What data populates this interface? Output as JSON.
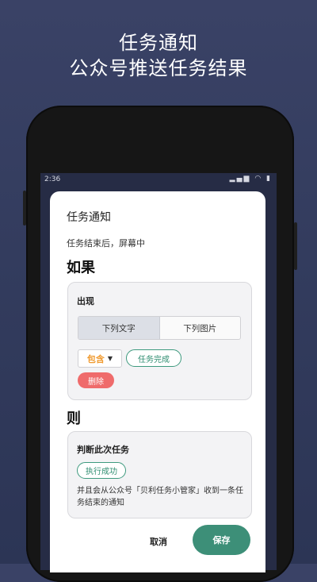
{
  "promo": {
    "line1": "任务通知",
    "line2": "公众号推送任务结果"
  },
  "status_bar": {
    "time": "2:36",
    "icons": [
      "signal-icon",
      "wifi-icon",
      "battery-icon"
    ]
  },
  "dialog": {
    "title": "任务通知",
    "subtitle": "任务结束后，屏幕中",
    "if_label": "如果",
    "condition": {
      "label": "出现",
      "segments": [
        "下列文字",
        "下列图片"
      ],
      "selected_segment": "下列文字",
      "match_value": "包含",
      "keyword_chip": "任务完成",
      "delete_label": "删除"
    },
    "then_label": "则",
    "action": {
      "label": "判断此次任务",
      "result_chip": "执行成功",
      "description": "并且会从公众号「贝利任务小管家」收到一条任务结束的通知"
    },
    "cancel_label": "取消",
    "save_label": "保存"
  },
  "colors": {
    "background": "#333c5e",
    "accent_green": "#3d8f78",
    "delete_red": "#ef6b6b",
    "dropdown_orange": "#f09a2e"
  }
}
